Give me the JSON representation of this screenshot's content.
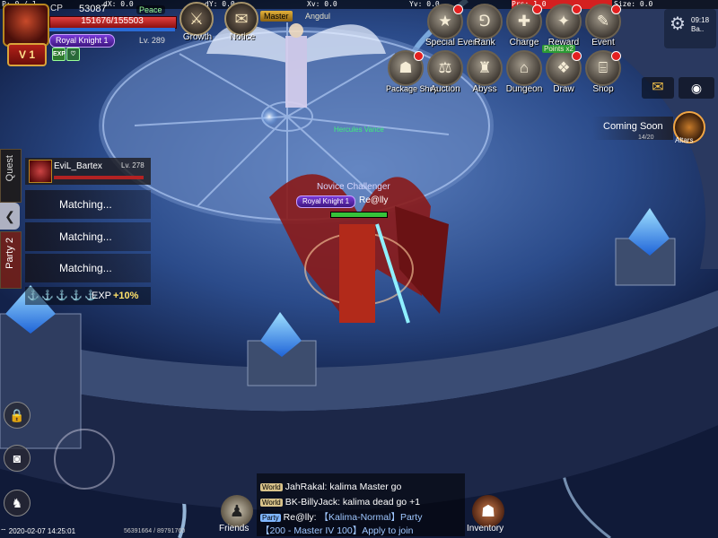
{
  "debug": {
    "p": "P: 0 / 1",
    "dx": "dX: 0.0",
    "dy": "dY: 0.0",
    "xv": "Xv: 0.0",
    "yv": "Yv: 0.0",
    "prs": "Prs: 1.0",
    "size": "Size: 0.0"
  },
  "player": {
    "cp_label": "CP",
    "cp_value": "53087",
    "mode": "Peace",
    "hp_text": "151676/155503",
    "hp_fraction": 0.975,
    "level_badge": "V 1",
    "title": "Royal Knight 1",
    "level": "Lv. 289",
    "buff_exp": "EXP"
  },
  "top_icons": [
    {
      "label": "Growth",
      "icon": "crossed-swords-icon",
      "glyph": "⚔"
    },
    {
      "label": "Notice",
      "icon": "scroll-icon",
      "glyph": "✉"
    }
  ],
  "npc": {
    "title": "Master",
    "name": "Angdul"
  },
  "menu_row1": [
    {
      "label": "Special Event",
      "icon": "special-event-icon",
      "glyph": "★",
      "dot": true
    },
    {
      "label": "Rank",
      "icon": "rank-icon",
      "glyph": "⅁",
      "dot": false
    },
    {
      "label": "Charge",
      "icon": "charge-icon",
      "glyph": "✚",
      "dot": true
    },
    {
      "label": "Reward",
      "icon": "reward-icon",
      "glyph": "✦",
      "dot": true
    },
    {
      "label": "Event",
      "icon": "event-icon",
      "glyph": "✎",
      "dot": true
    }
  ],
  "menu_row2": [
    {
      "label": "Package Shop",
      "icon": "package-icon",
      "glyph": "☗",
      "dot": true
    },
    {
      "label": "Auction",
      "icon": "auction-scale-icon",
      "glyph": "⚖",
      "dot": false
    },
    {
      "label": "Abyss",
      "icon": "abyss-icon",
      "glyph": "♜",
      "dot": false
    },
    {
      "label": "Dungeon",
      "icon": "dungeon-icon",
      "glyph": "⌂",
      "dot": false
    },
    {
      "label": "Draw",
      "icon": "draw-icon",
      "glyph": "❖",
      "dot": true,
      "badge": "Points x2"
    },
    {
      "label": "Shop",
      "icon": "shop-icon",
      "glyph": "⌸",
      "dot": true
    }
  ],
  "status": {
    "time": "09:18",
    "extra": "Ba.."
  },
  "coming_soon": {
    "label": "Coming Soon",
    "sub": "14/20",
    "altar": "Altars"
  },
  "party": {
    "tab_quest": "Quest",
    "tab_party": "Party 2",
    "member": {
      "name": "EviL_Bartex",
      "level": "Lv. 278"
    },
    "slots": [
      "Matching...",
      "Matching...",
      "Matching..."
    ],
    "exp_bonus": "+10%",
    "exp_label": "EXP"
  },
  "character": {
    "guild": "Novice Challenger",
    "title": "Royal Knight 1",
    "name": "Re@lly",
    "ally_name": "Hercules Vance"
  },
  "chat": [
    {
      "channel": "World",
      "color": "#d9c38a",
      "text_user": "JahRakal:",
      "text": " kalima Master go"
    },
    {
      "channel": "World",
      "color": "#d9c38a",
      "text_user": "BK-BillyJack:",
      "text": " kalima dead go +1"
    },
    {
      "channel": "Party",
      "color": "#7fb6ff",
      "text_user": "Re@lly:",
      "text": " 【Kalima-Normal】Party"
    },
    {
      "channel": "",
      "color": "#7fb6ff",
      "text_user": "",
      "text": "【200 - Master IV 100】Apply to join"
    }
  ],
  "bottom": {
    "datetime": "2020-02-07 14:25:01",
    "coords": "56391664 / 89791760",
    "friends": "Friends",
    "inventory": "Inventory"
  }
}
